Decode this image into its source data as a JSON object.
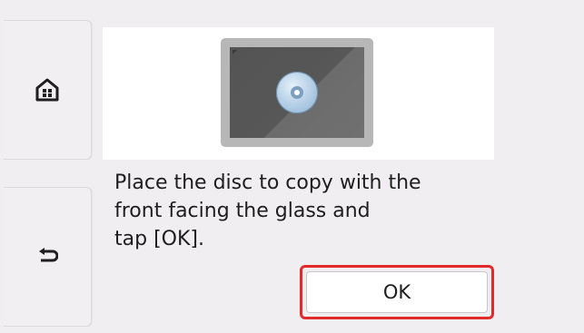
{
  "nav": {
    "home_icon": "home-icon",
    "back_icon": "back-arrow-icon"
  },
  "preview": {
    "illustration": "disc-on-glass-icon"
  },
  "message": {
    "lines": [
      "Place the disc to copy with the",
      "front facing the glass and",
      "tap [OK]."
    ]
  },
  "ok_button": {
    "label": "OK"
  },
  "colors": {
    "background": "#f0eef0",
    "highlight": "#e32a2a",
    "text": "#1e1e1e"
  }
}
